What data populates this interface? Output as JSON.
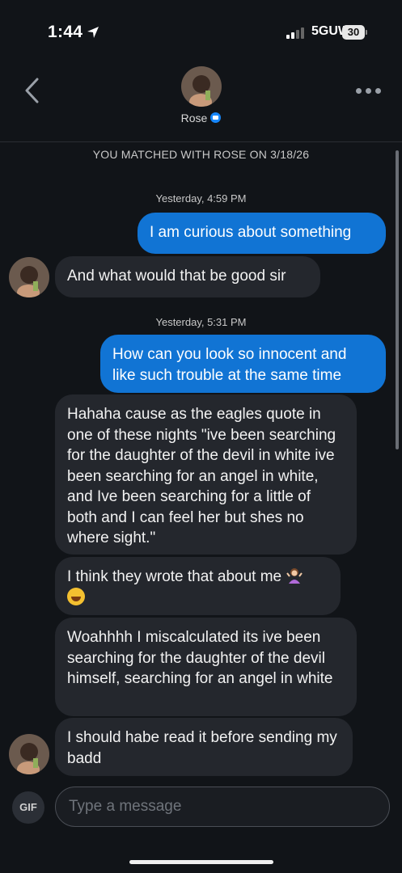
{
  "status": {
    "time": "1:44",
    "network": "5GUW",
    "battery": "30"
  },
  "header": {
    "name": "Rose"
  },
  "matched_banner": "YOU MATCHED WITH ROSE ON 3/18/26",
  "timestamps": [
    "Yesterday, 4:59 PM",
    "Yesterday, 5:31 PM"
  ],
  "messages": [
    {
      "from": "me",
      "text": "I am curious about something"
    },
    {
      "from": "them",
      "text": "And what would that be good sir"
    },
    {
      "from": "me",
      "text": "How can you look so innocent and like such trouble at the same time"
    },
    {
      "from": "them",
      "text": "Hahaha cause as the eagles quote in one of these nights \"ive been searching for the daughter of the devil in white ive been searching for an angel in white, and Ive been searching for a little of both and I can feel her but shes no where sight.\""
    },
    {
      "from": "them",
      "text": "I think they wrote that about me"
    },
    {
      "from": "them",
      "text": "Woahhhh I miscalculated its ive been searching for the daughter of the devil himself, searching for an angel in white"
    },
    {
      "from": "them",
      "text": "I should habe read it before sending my badd"
    }
  ],
  "emojis": [
    "person-shrugging-icon",
    "tears-of-joy-icon"
  ],
  "input": {
    "gif_label": "GIF",
    "placeholder": "Type a message"
  },
  "colors": {
    "sent_bubble": "#1174d4",
    "received_bubble": "#24272d",
    "background": "#111418",
    "verified": "#1786f8"
  }
}
